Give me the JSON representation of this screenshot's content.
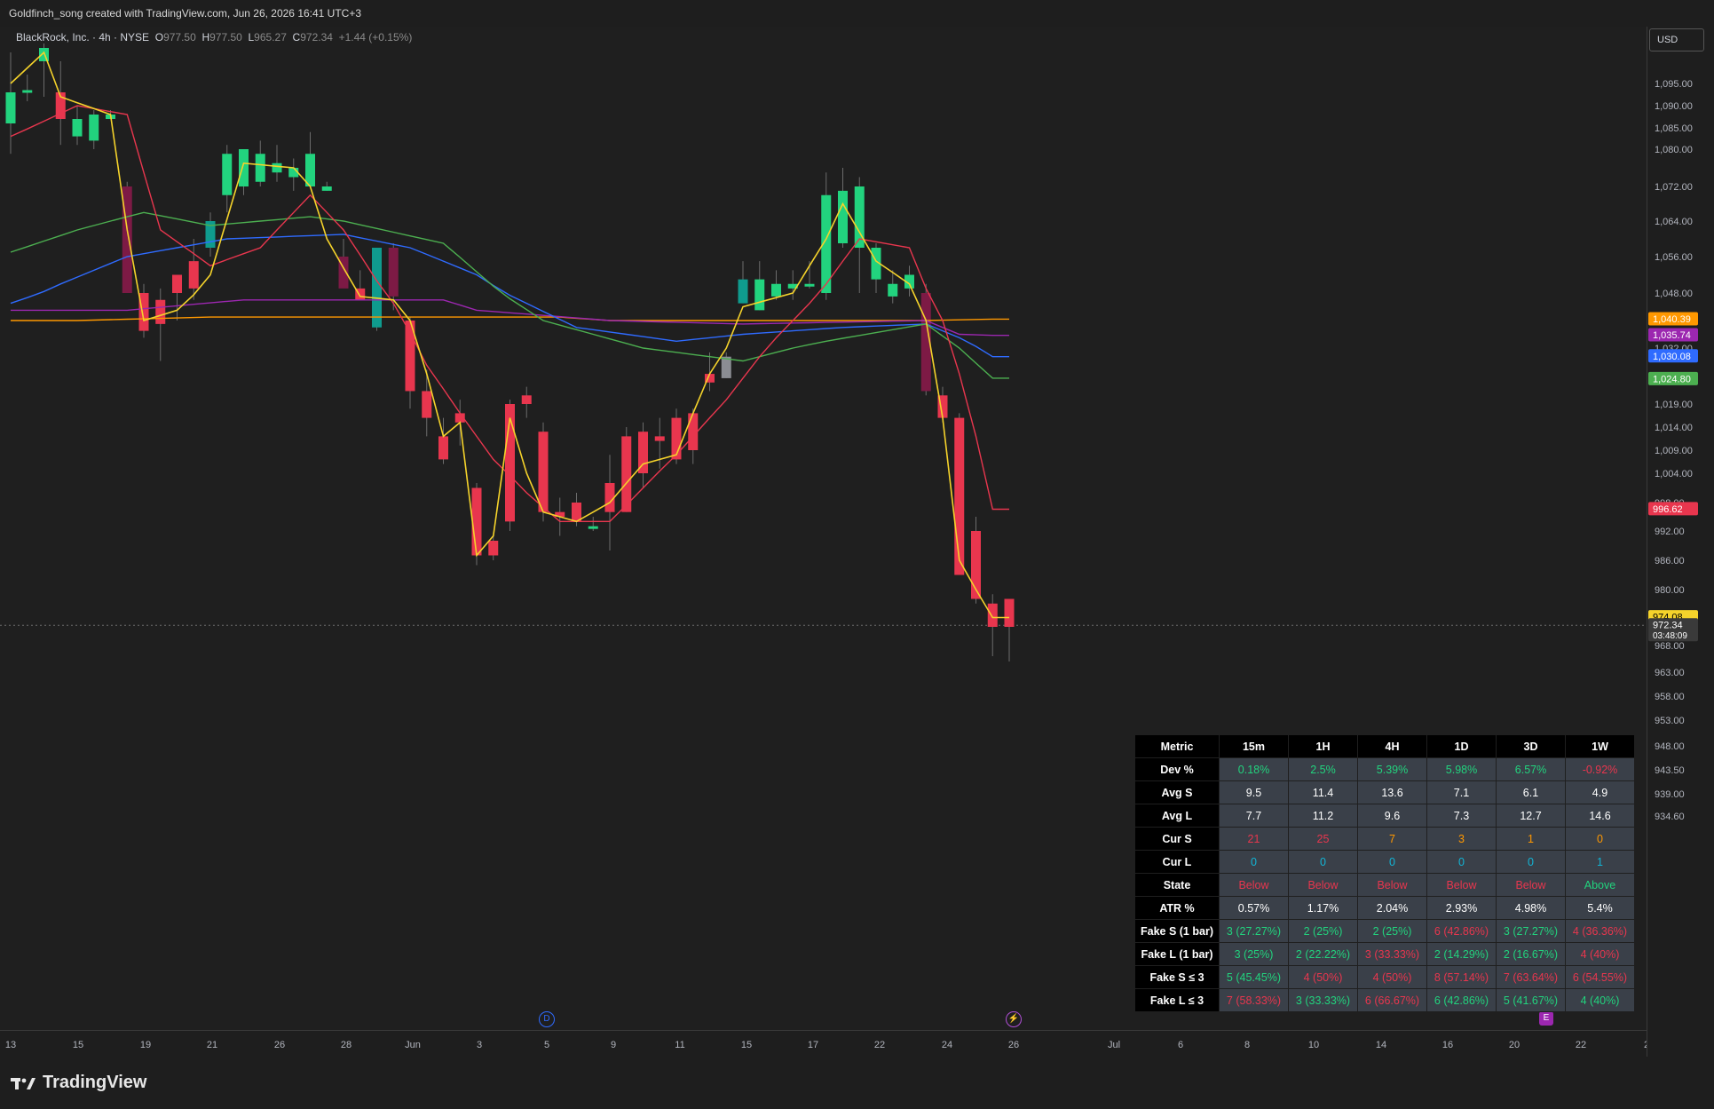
{
  "header": {
    "caption": "Goldfinch_song created with TradingView.com, Jun 26, 2026 16:41 UTC+3"
  },
  "legend": {
    "symbol": "BlackRock, Inc. · 4h · NYSE",
    "open_label": "O",
    "open": "977.50",
    "high_label": "H",
    "high": "977.50",
    "low_label": "L",
    "low": "965.27",
    "close_label": "C",
    "close": "972.34",
    "change": "+1.44 (+0.15%)"
  },
  "currency_button": "USD",
  "footer": {
    "brand": "TradingView"
  },
  "events": {
    "dividend_marker": "D",
    "earnings_marker": "E"
  },
  "colors": {
    "up": "#22d37e",
    "down": "#e8364e",
    "up_dark": "#0f9b8e",
    "down_dark": "#7d1a45",
    "neutral": "#8b8d93",
    "yellow_line": "#f5d32b",
    "red_line": "#e8364e",
    "green_ma": "#4caf50",
    "blue_ma": "#2f6bff",
    "purple_ma": "#9c27b0",
    "orange_ma": "#ff9800"
  },
  "chart_data": {
    "type": "candlestick",
    "symbol": "BlackRock, Inc.",
    "interval": "4h",
    "y_axis": {
      "ticks": [
        "1,095.00",
        "1,090.00",
        "1,085.00",
        "1,080.00",
        "1,072.00",
        "1,064.00",
        "1,056.00",
        "1,048.00",
        "1,032.00",
        "1,019.00",
        "1,014.00",
        "1,009.00",
        "1,004.00",
        "998.00",
        "992.00",
        "986.00",
        "980.00",
        "968.00",
        "963.00",
        "958.00",
        "953.00",
        "948.00",
        "943.50",
        "939.00",
        "934.60"
      ],
      "tick_values": [
        1095,
        1090,
        1085,
        1080,
        1072,
        1064,
        1056,
        1048,
        1032,
        1019,
        1014,
        1009,
        1004,
        998,
        992,
        986,
        980,
        968,
        963,
        958,
        953,
        948,
        943.5,
        939,
        934.6
      ]
    },
    "x_axis": {
      "ticks": [
        "13",
        "15",
        "19",
        "21",
        "26",
        "28",
        "Jun",
        "3",
        "5",
        "9",
        "11",
        "15",
        "17",
        "22",
        "24",
        "26",
        "Jul",
        "6",
        "8",
        "10",
        "14",
        "16",
        "20",
        "22",
        "2"
      ]
    },
    "price_labels": [
      {
        "value": 1040.39,
        "text": "1,040.39",
        "color": "#ff9800"
      },
      {
        "value": 1035.74,
        "text": "1,035.74",
        "color": "#9c27b0"
      },
      {
        "value": 1030.08,
        "text": "1,030.08",
        "color": "#2f6bff"
      },
      {
        "value": 1024.8,
        "text": "1,024.80",
        "color": "#4caf50"
      },
      {
        "value": 996.62,
        "text": "996.62",
        "color": "#e8364e"
      },
      {
        "value": 974.08,
        "text": "974.08",
        "color": "#f5d32b"
      },
      {
        "value": 972.34,
        "text": "972.34",
        "countdown": "03:48:09",
        "color": "#3a3a3a"
      }
    ],
    "candles": [
      {
        "o": 1093,
        "h": 1102,
        "l": 1079,
        "c": 1086,
        "t": "up"
      },
      {
        "o": 1093,
        "h": 1097,
        "l": 1091,
        "c": 1093.5,
        "t": "up"
      },
      {
        "o": 1100,
        "h": 1104,
        "l": 1092,
        "c": 1103,
        "t": "up"
      },
      {
        "o": 1093,
        "h": 1100,
        "l": 1081,
        "c": 1087,
        "t": "down"
      },
      {
        "o": 1087,
        "h": 1090,
        "l": 1081,
        "c": 1083,
        "t": "up"
      },
      {
        "o": 1082,
        "h": 1089,
        "l": 1080,
        "c": 1088,
        "t": "up"
      },
      {
        "o": 1088,
        "h": 1089,
        "l": 1087,
        "c": 1087,
        "t": "up"
      },
      {
        "o": 1072,
        "h": 1073,
        "l": 1048,
        "c": 1048,
        "t": "down_dark"
      },
      {
        "o": 1048,
        "h": 1050,
        "l": 1035,
        "c": 1037,
        "t": "down"
      },
      {
        "o": 1046,
        "h": 1049,
        "l": 1029,
        "c": 1039,
        "t": "down"
      },
      {
        "o": 1048,
        "h": 1051,
        "l": 1040,
        "c": 1052,
        "t": "down"
      },
      {
        "o": 1049,
        "h": 1060,
        "l": 1046,
        "c": 1055,
        "t": "down"
      },
      {
        "o": 1058,
        "h": 1066,
        "l": 1056,
        "c": 1064,
        "t": "up_dark"
      },
      {
        "o": 1070,
        "h": 1081,
        "l": 1066,
        "c": 1079,
        "t": "up"
      },
      {
        "o": 1072,
        "h": 1080,
        "l": 1070,
        "c": 1080,
        "t": "up"
      },
      {
        "o": 1073,
        "h": 1082,
        "l": 1072,
        "c": 1079,
        "t": "up"
      },
      {
        "o": 1077,
        "h": 1081,
        "l": 1073,
        "c": 1075,
        "t": "up"
      },
      {
        "o": 1074,
        "h": 1078,
        "l": 1071,
        "c": 1076,
        "t": "up"
      },
      {
        "o": 1079,
        "h": 1084,
        "l": 1073,
        "c": 1072,
        "t": "up"
      },
      {
        "o": 1072,
        "h": 1073,
        "l": 1071,
        "c": 1071,
        "t": "up"
      },
      {
        "o": 1056,
        "h": 1060,
        "l": 1050,
        "c": 1049,
        "t": "down_dark"
      },
      {
        "o": 1049,
        "h": 1053,
        "l": 1046,
        "c": 1046,
        "t": "down"
      },
      {
        "o": 1038,
        "h": 1058,
        "l": 1037,
        "c": 1058,
        "t": "up_dark"
      },
      {
        "o": 1058,
        "h": 1059,
        "l": 1043,
        "c": 1047,
        "t": "down_dark"
      },
      {
        "o": 1040,
        "h": 1041,
        "l": 1018,
        "c": 1022,
        "t": "down"
      },
      {
        "o": 1022,
        "h": 1027,
        "l": 1012,
        "c": 1016,
        "t": "down"
      },
      {
        "o": 1012,
        "h": 1016,
        "l": 1006,
        "c": 1007,
        "t": "down"
      },
      {
        "o": 1017,
        "h": 1020,
        "l": 1010,
        "c": 1015,
        "t": "down"
      },
      {
        "o": 1001,
        "h": 1002,
        "l": 985,
        "c": 987,
        "t": "down"
      },
      {
        "o": 990,
        "h": 991,
        "l": 986,
        "c": 987,
        "t": "down"
      },
      {
        "o": 1019,
        "h": 1020,
        "l": 992,
        "c": 994,
        "t": "down"
      },
      {
        "o": 1021,
        "h": 1023,
        "l": 1016,
        "c": 1019,
        "t": "down"
      },
      {
        "o": 1013,
        "h": 1015,
        "l": 994,
        "c": 996,
        "t": "down"
      },
      {
        "o": 995,
        "h": 999,
        "l": 991,
        "c": 996,
        "t": "down"
      },
      {
        "o": 998,
        "h": 1000,
        "l": 993,
        "c": 994,
        "t": "down"
      },
      {
        "o": 993,
        "h": 995,
        "l": 992,
        "c": 993,
        "t": "up"
      },
      {
        "o": 1002,
        "h": 1008,
        "l": 988,
        "c": 996,
        "t": "down"
      },
      {
        "o": 1012,
        "h": 1014,
        "l": 996,
        "c": 996,
        "t": "down"
      },
      {
        "o": 1004,
        "h": 1015,
        "l": 1001,
        "c": 1013,
        "t": "down"
      },
      {
        "o": 1012,
        "h": 1016,
        "l": 1005,
        "c": 1011,
        "t": "down"
      },
      {
        "o": 1016,
        "h": 1018,
        "l": 1006,
        "c": 1007,
        "t": "down"
      },
      {
        "o": 1009,
        "h": 1018,
        "l": 1006,
        "c": 1017,
        "t": "down"
      },
      {
        "o": 1026,
        "h": 1031,
        "l": 1022,
        "c": 1024,
        "t": "down"
      },
      {
        "o": 1025,
        "h": 1031,
        "l": 1025,
        "c": 1030,
        "t": "neutral"
      },
      {
        "o": 1051,
        "h": 1055,
        "l": 1045,
        "c": 1045,
        "t": "up_dark"
      },
      {
        "o": 1051,
        "h": 1055,
        "l": 1043,
        "c": 1043,
        "t": "up"
      },
      {
        "o": 1050,
        "h": 1053,
        "l": 1046,
        "c": 1047,
        "t": "up"
      },
      {
        "o": 1050,
        "h": 1053,
        "l": 1046,
        "c": 1049,
        "t": "up"
      },
      {
        "o": 1050,
        "h": 1055,
        "l": 1049,
        "c": 1050,
        "t": "up"
      },
      {
        "o": 1048,
        "h": 1075,
        "l": 1046,
        "c": 1070,
        "t": "up"
      },
      {
        "o": 1071,
        "h": 1076,
        "l": 1058,
        "c": 1059,
        "t": "up"
      },
      {
        "o": 1072,
        "h": 1074,
        "l": 1048,
        "c": 1058,
        "t": "up"
      },
      {
        "o": 1058,
        "h": 1059,
        "l": 1048,
        "c": 1051,
        "t": "up"
      },
      {
        "o": 1047,
        "h": 1053,
        "l": 1045,
        "c": 1050,
        "t": "up"
      },
      {
        "o": 1049,
        "h": 1054,
        "l": 1047,
        "c": 1052,
        "t": "up"
      },
      {
        "o": 1048,
        "h": 1050,
        "l": 1021,
        "c": 1022,
        "t": "down_dark"
      },
      {
        "o": 1021,
        "h": 1023,
        "l": 1015,
        "c": 1016,
        "t": "down"
      },
      {
        "o": 1016,
        "h": 1017,
        "l": 983,
        "c": 983,
        "t": "down"
      },
      {
        "o": 992,
        "h": 995,
        "l": 977,
        "c": 978,
        "t": "down"
      },
      {
        "o": 977,
        "h": 979,
        "l": 966,
        "c": 972,
        "t": "down"
      },
      {
        "o": 978,
        "h": 978,
        "l": 965,
        "c": 972,
        "t": "down"
      }
    ],
    "stats_table": {
      "headers": [
        "Metric",
        "15m",
        "1H",
        "4H",
        "1D",
        "3D",
        "1W"
      ],
      "rows": [
        {
          "metric": "Dev %",
          "values": [
            "0.18%",
            "2.5%",
            "5.39%",
            "5.98%",
            "6.57%",
            "-0.92%"
          ],
          "colors": [
            "#22d37e",
            "#22d37e",
            "#22d37e",
            "#22d37e",
            "#22d37e",
            "#e8364e"
          ]
        },
        {
          "metric": "Avg S",
          "values": [
            "9.5",
            "11.4",
            "13.6",
            "7.1",
            "6.1",
            "4.9"
          ],
          "colors": [
            "#ffffff",
            "#ffffff",
            "#ffffff",
            "#ffffff",
            "#ffffff",
            "#ffffff"
          ]
        },
        {
          "metric": "Avg L",
          "values": [
            "7.7",
            "11.2",
            "9.6",
            "7.3",
            "12.7",
            "14.6"
          ],
          "colors": [
            "#ffffff",
            "#ffffff",
            "#ffffff",
            "#ffffff",
            "#ffffff",
            "#ffffff"
          ]
        },
        {
          "metric": "Cur S",
          "values": [
            "21",
            "25",
            "7",
            "3",
            "1",
            "0"
          ],
          "colors": [
            "#e8364e",
            "#e8364e",
            "#ff9800",
            "#ff9800",
            "#ff9800",
            "#ff9800"
          ]
        },
        {
          "metric": "Cur L",
          "values": [
            "0",
            "0",
            "0",
            "0",
            "0",
            "1"
          ],
          "colors": [
            "#12b5d6",
            "#12b5d6",
            "#12b5d6",
            "#12b5d6",
            "#12b5d6",
            "#12b5d6"
          ]
        },
        {
          "metric": "State",
          "values": [
            "Below",
            "Below",
            "Below",
            "Below",
            "Below",
            "Above"
          ],
          "colors": [
            "#e8364e",
            "#e8364e",
            "#e8364e",
            "#e8364e",
            "#e8364e",
            "#22d37e"
          ]
        },
        {
          "metric": "ATR %",
          "values": [
            "0.57%",
            "1.17%",
            "2.04%",
            "2.93%",
            "4.98%",
            "5.4%"
          ],
          "colors": [
            "#ffffff",
            "#ffffff",
            "#ffffff",
            "#ffffff",
            "#ffffff",
            "#ffffff"
          ]
        },
        {
          "metric": "Fake S (1 bar)",
          "values": [
            "3 (27.27%)",
            "2 (25%)",
            "2 (25%)",
            "6 (42.86%)",
            "3 (27.27%)",
            "4 (36.36%)"
          ],
          "colors": [
            "#22d37e",
            "#22d37e",
            "#22d37e",
            "#e8364e",
            "#22d37e",
            "#e8364e"
          ]
        },
        {
          "metric": "Fake L (1 bar)",
          "values": [
            "3 (25%)",
            "2 (22.22%)",
            "3 (33.33%)",
            "2 (14.29%)",
            "2 (16.67%)",
            "4 (40%)"
          ],
          "colors": [
            "#22d37e",
            "#22d37e",
            "#e8364e",
            "#22d37e",
            "#22d37e",
            "#e8364e"
          ]
        },
        {
          "metric": "Fake S ≤ 3",
          "values": [
            "5 (45.45%)",
            "4 (50%)",
            "4 (50%)",
            "8 (57.14%)",
            "7 (63.64%)",
            "6 (54.55%)"
          ],
          "colors": [
            "#22d37e",
            "#e8364e",
            "#e8364e",
            "#e8364e",
            "#e8364e",
            "#e8364e"
          ]
        },
        {
          "metric": "Fake L ≤ 3",
          "values": [
            "7 (58.33%)",
            "3 (33.33%)",
            "6 (66.67%)",
            "6 (42.86%)",
            "5 (41.67%)",
            "4 (40%)"
          ],
          "colors": [
            "#e8364e",
            "#22d37e",
            "#e8364e",
            "#22d37e",
            "#22d37e",
            "#22d37e"
          ]
        }
      ]
    }
  }
}
